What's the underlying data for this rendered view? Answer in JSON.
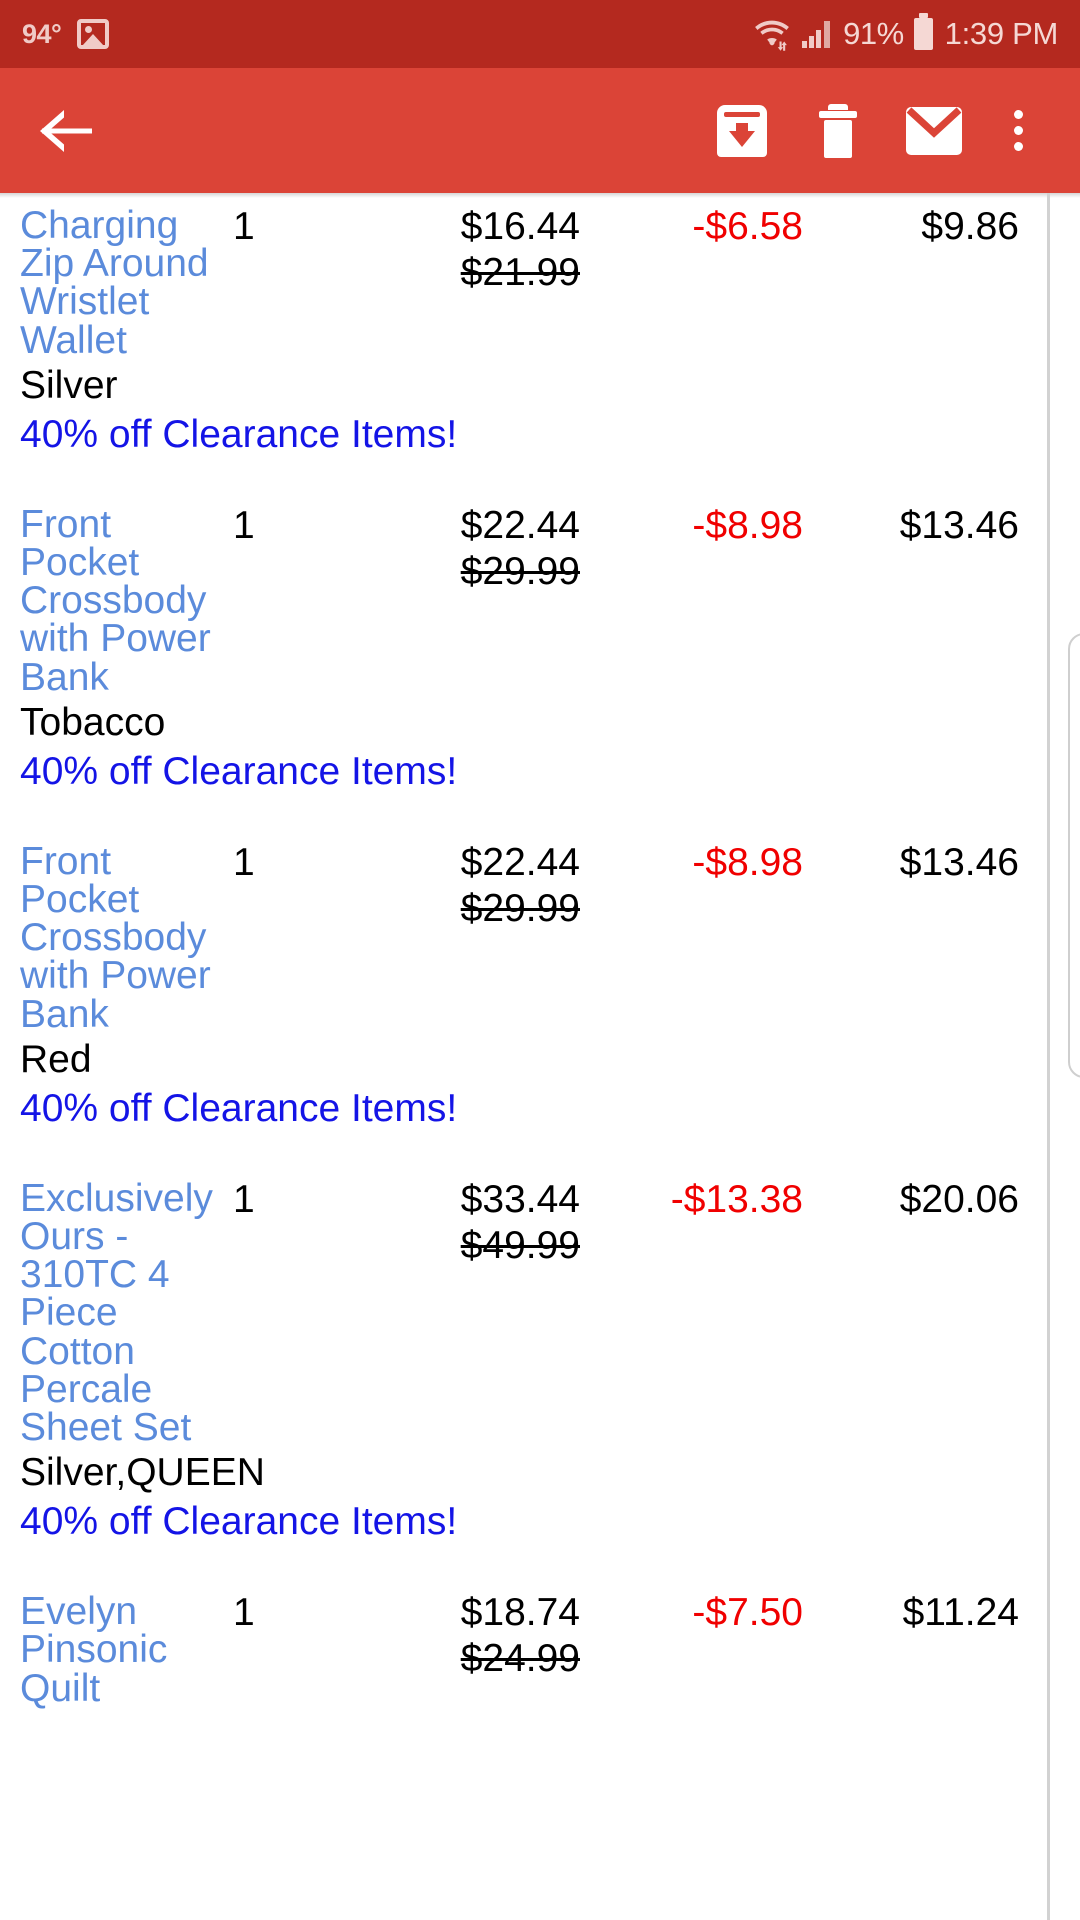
{
  "status_bar": {
    "temperature": "94°",
    "photo_icon": "photo-icon",
    "wifi_icon": "wifi-icon",
    "signal_icon": "cellular-signal-icon",
    "battery_percent": "91%",
    "battery_icon": "battery-icon",
    "time": "1:39 PM"
  },
  "app_bar": {
    "back_icon": "arrow-back-icon",
    "archive_icon": "archive-icon",
    "delete_icon": "trash-icon",
    "mark_unread_icon": "envelope-icon",
    "overflow_icon": "overflow-menu-icon"
  },
  "colors": {
    "status_bar_bg": "#b4291f",
    "app_bar_bg": "#db4437",
    "link_blue": "#5b8bdb",
    "promo_blue": "#1414e6",
    "discount_red": "#f00000",
    "text_black": "#000000"
  },
  "items": [
    {
      "name_lines": [
        "Charging",
        "Zip Around",
        "Wristlet",
        "Wallet"
      ],
      "qty": "1",
      "price": "$16.44",
      "original_price": "$21.99",
      "discount": "-$6.58",
      "total": "$9.86",
      "variant": "Silver",
      "promo": "40% off Clearance Items!"
    },
    {
      "name_lines": [
        "Front",
        "Pocket",
        "Crossbody",
        "with Power",
        "Bank"
      ],
      "qty": "1",
      "price": "$22.44",
      "original_price": "$29.99",
      "discount": "-$8.98",
      "total": "$13.46",
      "variant": "Tobacco",
      "promo": "40% off Clearance Items!"
    },
    {
      "name_lines": [
        "Front",
        "Pocket",
        "Crossbody",
        "with Power",
        "Bank"
      ],
      "qty": "1",
      "price": "$22.44",
      "original_price": "$29.99",
      "discount": "-$8.98",
      "total": "$13.46",
      "variant": "Red",
      "promo": "40% off Clearance Items!"
    },
    {
      "name_lines": [
        "Exclusively",
        "Ours -",
        "310TC 4",
        "Piece",
        "Cotton",
        "Percale",
        "Sheet Set"
      ],
      "qty": "1",
      "price": "$33.44",
      "original_price": "$49.99",
      "discount": "-$13.38",
      "total": "$20.06",
      "variant": "Silver,QUEEN",
      "promo": "40% off Clearance Items!"
    },
    {
      "name_lines": [
        "Evelyn",
        "Pinsonic",
        "Quilt"
      ],
      "qty": "1",
      "price": "$18.74",
      "original_price": "$24.99",
      "discount": "-$7.50",
      "total": "$11.24",
      "variant": "",
      "promo": ""
    }
  ]
}
